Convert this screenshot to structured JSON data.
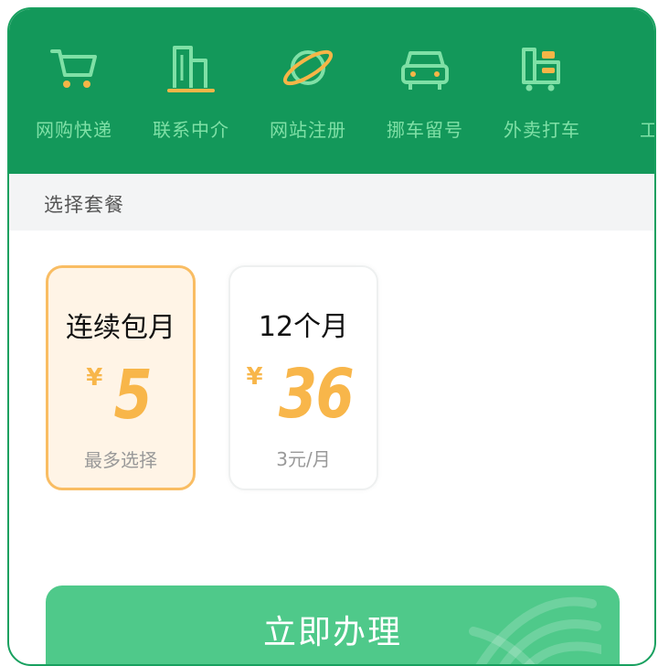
{
  "nav": {
    "items": [
      {
        "label": "网购快递",
        "icon": "cart-icon"
      },
      {
        "label": "联系中介",
        "icon": "building-icon"
      },
      {
        "label": "网站注册",
        "icon": "planet-icon"
      },
      {
        "label": "挪车留号",
        "icon": "car-icon"
      },
      {
        "label": "外卖打车",
        "icon": "delivery-truck-icon"
      },
      {
        "label": "工作",
        "icon": "partial-icon"
      }
    ]
  },
  "section": {
    "title": "选择套餐"
  },
  "plans": [
    {
      "name": "连续包月",
      "currency": "¥",
      "amount": "5",
      "note": "最多选择",
      "selected": true
    },
    {
      "name": "12个月",
      "currency": "¥",
      "amount": "36",
      "note": "3元/月",
      "selected": false
    }
  ],
  "cta": {
    "label": "立即办理"
  },
  "colors": {
    "header_bg": "#13985a",
    "nav_accent": "#7fe0a6",
    "icon_secondary": "#f6b547",
    "price_color": "#f8b64a",
    "selected_border": "#f9bd63",
    "selected_bg": "#fff4e6",
    "cta_bg": "#4fc98a"
  }
}
